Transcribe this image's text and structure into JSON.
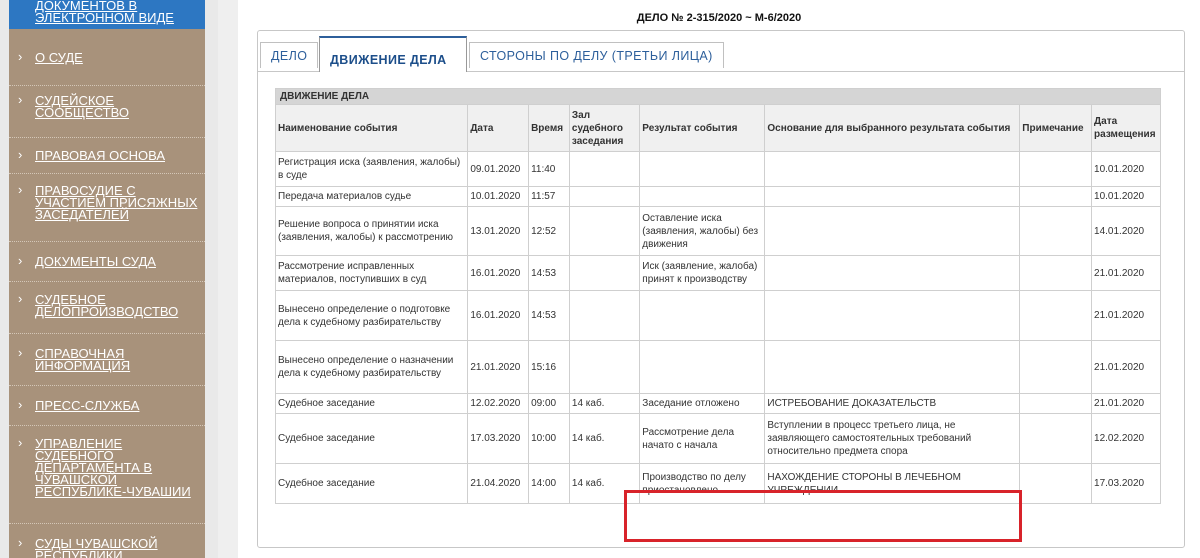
{
  "sidebar": {
    "items": [
      {
        "arrow": "",
        "label": "ДОКУМЕНТОВ В ЭЛЕКТРОННОМ ВИДЕ",
        "active": true
      },
      {
        "arrow": "›",
        "label": "О СУДЕ"
      },
      {
        "arrow": "›",
        "label": "СУДЕЙСКОЕ СООБЩЕСТВО"
      },
      {
        "arrow": "›",
        "label": "ПРАВОВАЯ ОСНОВА"
      },
      {
        "arrow": "›",
        "label": "ПРАВОСУДИЕ С УЧАСТИЕМ ПРИСЯЖНЫХ ЗАСЕДАТЕЛЕЙ"
      },
      {
        "arrow": "›",
        "label": "ДОКУМЕНТЫ СУДА"
      },
      {
        "arrow": "›",
        "label": "СУДЕБНОЕ ДЕЛОПРОИЗВОДСТВО"
      },
      {
        "arrow": "›",
        "label": "СПРАВОЧНАЯ ИНФОРМАЦИЯ"
      },
      {
        "arrow": "›",
        "label": "ПРЕСС-СЛУЖБА"
      },
      {
        "arrow": "›",
        "label": "УПРАВЛЕНИЕ СУДЕБНОГО ДЕПАРТАМЕНТА В ЧУВАШСКОЙ РЕСПУБЛИКЕ-ЧУВАШИИ"
      },
      {
        "arrow": "›",
        "label": "СУДЫ ЧУВАШСКОЙ РЕСПУБЛИКИ"
      }
    ]
  },
  "case": {
    "title": "ДЕЛО № 2-315/2020 ~ М-6/2020"
  },
  "tabs": [
    {
      "label": "ДЕЛО"
    },
    {
      "label": "ДВИЖЕНИЕ ДЕЛА",
      "selected": true
    },
    {
      "label": "СТОРОНЫ ПО ДЕЛУ (ТРЕТЬИ ЛИЦА)"
    }
  ],
  "table": {
    "section_title": "ДВИЖЕНИЕ ДЕЛА",
    "headers": [
      "Наименование события",
      "Дата",
      "Время",
      "Зал судебного заседания",
      "Результат события",
      "Основание для выбранного результата события",
      "Примечание",
      "Дата размещения"
    ],
    "rows": [
      [
        "Регистрация иска (заявления, жалобы) в суде",
        "09.01.2020",
        "11:40",
        "",
        "",
        "",
        "",
        "10.01.2020"
      ],
      [
        "Передача материалов судье",
        "10.01.2020",
        "11:57",
        "",
        "",
        "",
        "",
        "10.01.2020"
      ],
      [
        "Решение вопроса о принятии иска (заявления, жалобы) к рассмотрению",
        "13.01.2020",
        "12:52",
        "",
        "Оставление иска (заявления, жалобы) без движения",
        "",
        "",
        "14.01.2020"
      ],
      [
        "Рассмотрение исправленных материалов, поступивших в суд",
        "16.01.2020",
        "14:53",
        "",
        "Иск (заявление, жалоба) принят к производству",
        "",
        "",
        "21.01.2020"
      ],
      [
        "Вынесено определение о подготовке дела к судебному разбирательству",
        "16.01.2020",
        "14:53",
        "",
        "",
        "",
        "",
        "21.01.2020"
      ],
      [
        "Вынесено определение о назначении дела к судебному разбирательству",
        "21.01.2020",
        "15:16",
        "",
        "",
        "",
        "",
        "21.01.2020"
      ],
      [
        "Судебное заседание",
        "12.02.2020",
        "09:00",
        "14 каб.",
        "Заседание отложено",
        "ИСТРЕБОВАНИЕ ДОКАЗАТЕЛЬСТВ",
        "",
        "21.01.2020"
      ],
      [
        "Судебное заседание",
        "17.03.2020",
        "10:00",
        "14 каб.",
        "Рассмотрение дела начато с начала",
        "Вступлении в процесс третьего лица, не заявляющего самостоятельных требований относительно предмета спора",
        "",
        "12.02.2020"
      ],
      [
        "Судебное заседание",
        "21.04.2020",
        "14:00",
        "14 каб.",
        "Производство по делу приостановлено",
        "НАХОЖДЕНИЕ СТОРОНЫ В ЛЕЧЕБНОМ УЧРЕЖДЕНИИ",
        "",
        "17.03.2020"
      ]
    ]
  },
  "highlight_color": "#d8232a",
  "accent_color": "#2d77c2"
}
